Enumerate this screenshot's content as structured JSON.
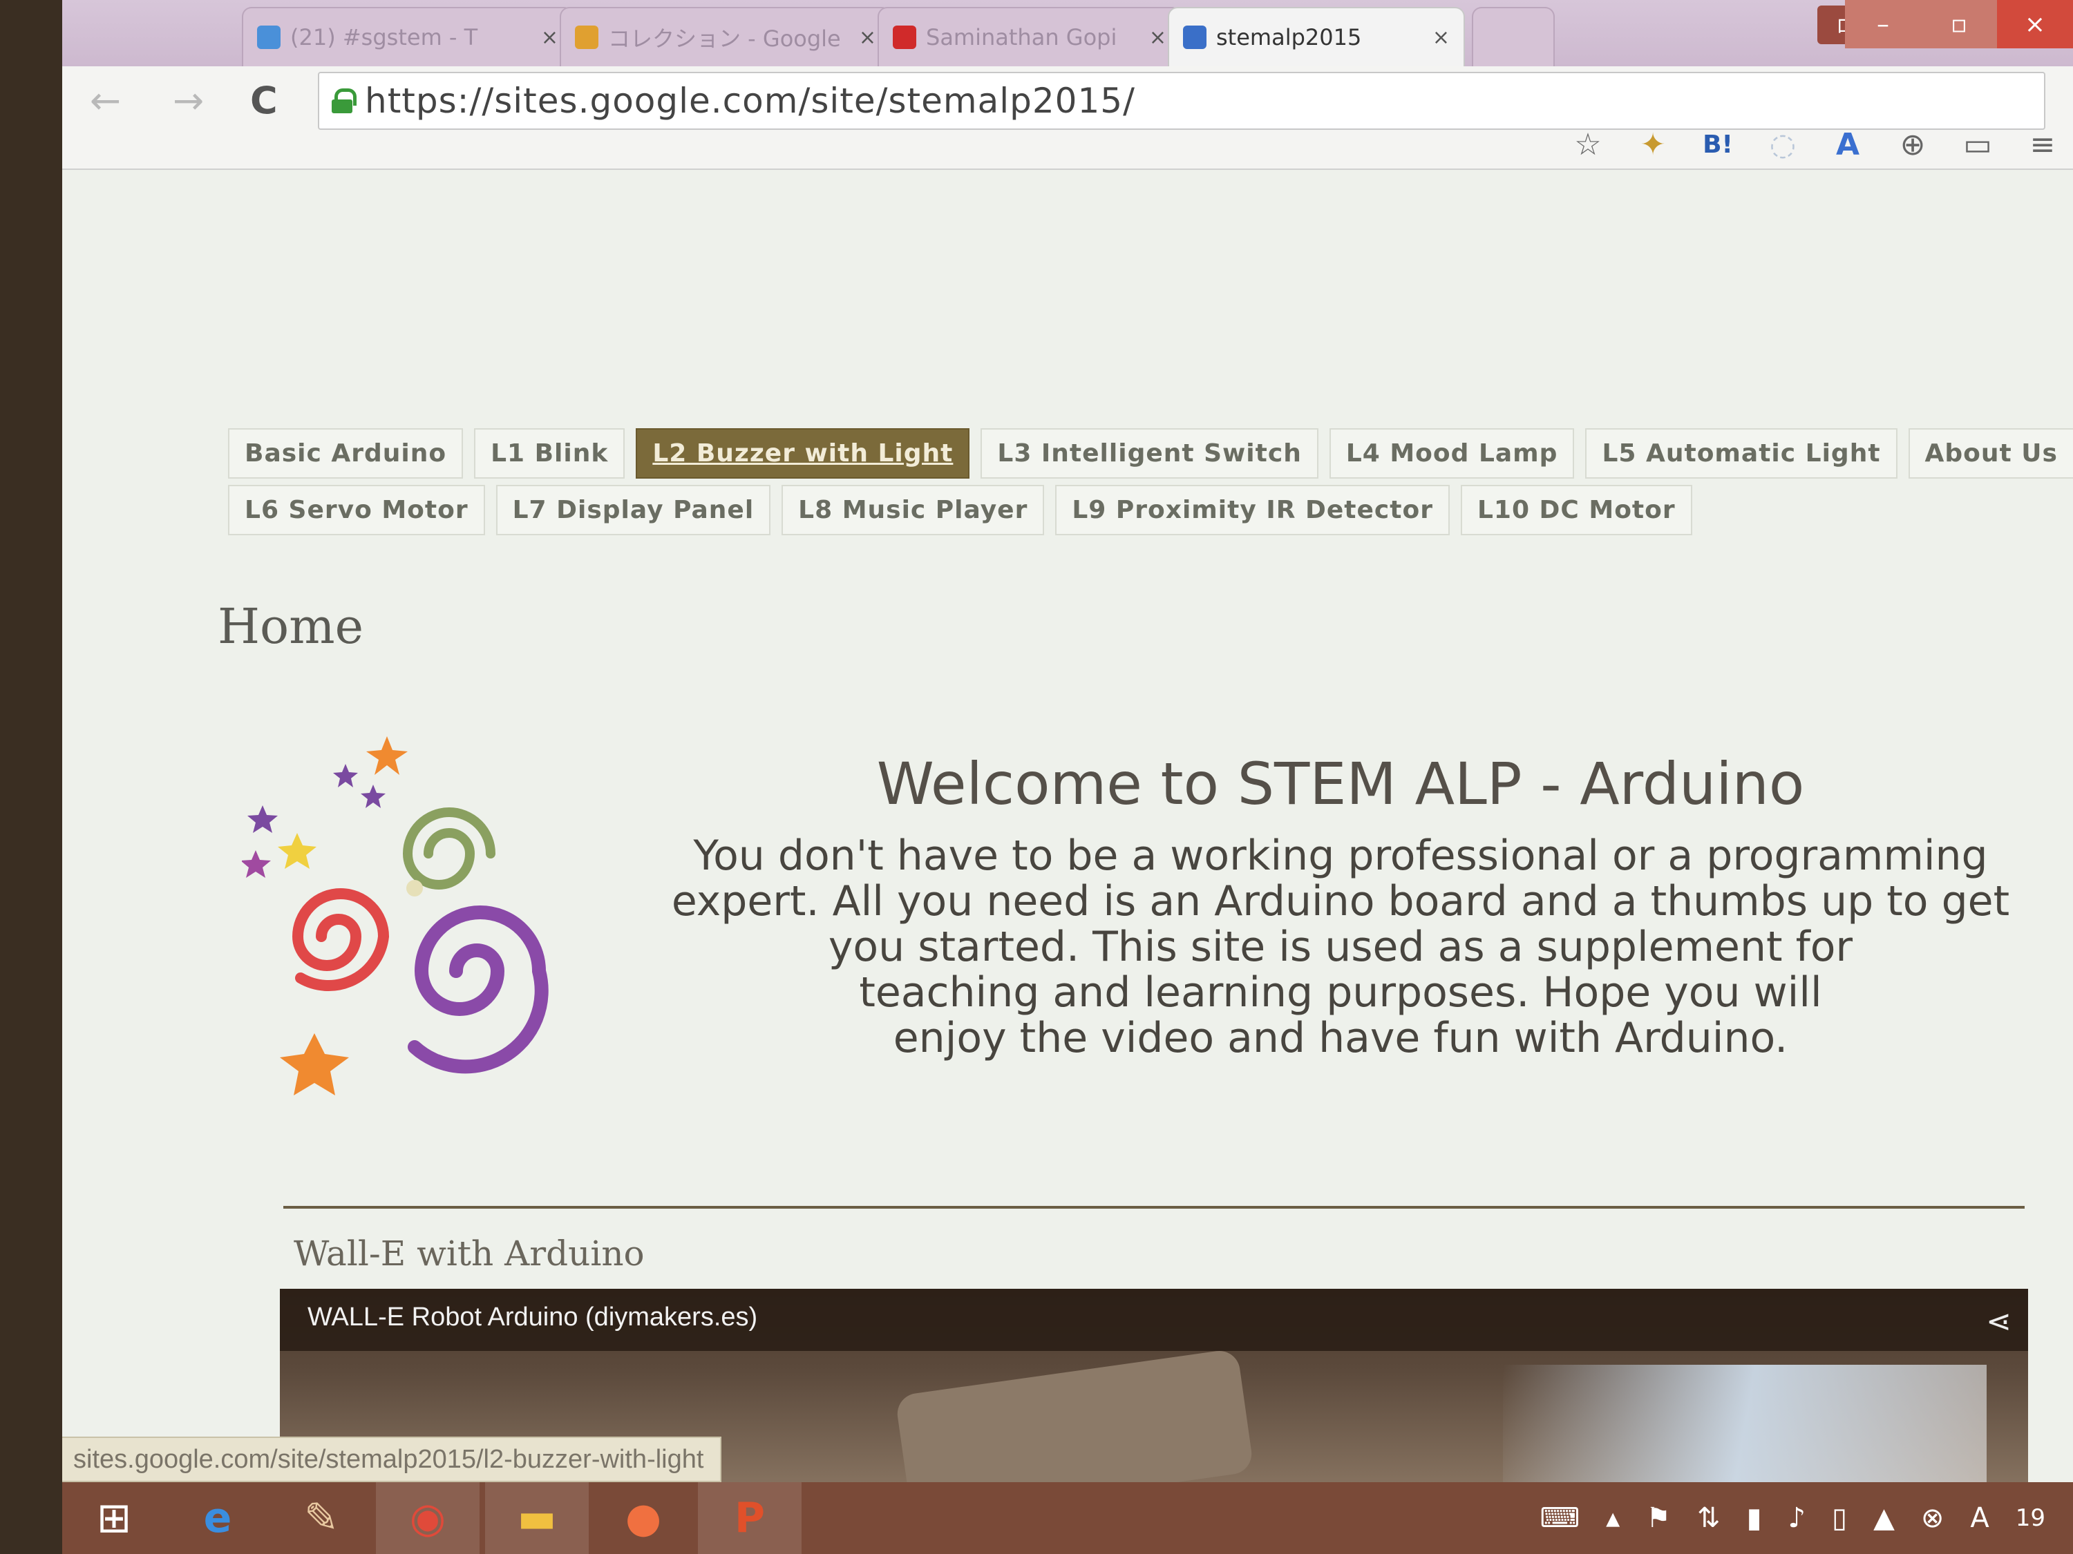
{
  "browser": {
    "tabs": [
      {
        "label": "(21) #sgstem - T",
        "icon": "twitter-icon",
        "icon_color": "#4a90d9"
      },
      {
        "label": "コレクション - Google",
        "icon": "google-icon",
        "icon_color": "#e0a030"
      },
      {
        "label": "Saminathan Gopi",
        "icon": "youtube-icon",
        "icon_color": "#d02a2a"
      },
      {
        "label": "stemalp2015",
        "icon": "sites-icon",
        "icon_color": "#3a6fc8",
        "active": true
      }
    ],
    "tab_close": "×",
    "new_tab": "",
    "profile_label": "ログ",
    "window_controls": {
      "minimize": "–",
      "restore": "▫",
      "close": "×"
    },
    "nav": {
      "back": "←",
      "forward": "→",
      "reload": "C"
    },
    "url": "https://sites.google.com/site/stemalp2015/",
    "extensions": [
      "star-icon",
      "puzzle-icon",
      "bookmark-icon",
      "ghost-icon",
      "translate-icon",
      "shield-icon",
      "cast-icon",
      "menu-icon"
    ],
    "extension_glyphs": [
      "☆",
      "✦",
      "B!",
      "◌",
      "A",
      "⊕",
      "▭",
      "≡"
    ]
  },
  "site": {
    "nav_row1": [
      "Basic Arduino",
      "L1 Blink",
      "L2 Buzzer with Light",
      "L3 Intelligent Switch",
      "L4 Mood Lamp",
      "L5 Automatic Light",
      "About Us"
    ],
    "nav_row2": [
      "L6 Servo Motor",
      "L7 Display Panel",
      "L8 Music Player",
      "L9 Proximity IR Detector",
      "L10 DC Motor"
    ],
    "selected_tab": "L2 Buzzer with Light",
    "page_title": "Home",
    "welcome_title": "Welcome to STEM ALP - Arduino",
    "welcome_lines": [
      "You don't have to be a working professional or a programming",
      "expert.  All you need is an Arduino board and a thumbs up to get",
      "you started. This site is used as a supplement for",
      "teaching and learning purposes. Hope you will",
      "enjoy the video and have fun with Arduino."
    ],
    "section_title": "Wall-E with Arduino",
    "video_title": "WALL-E Robot Arduino (diymakers.es)",
    "status_url": "sites.google.com/site/stemalp2015/l2-buzzer-with-light",
    "accent_color": "#7b6a3a"
  },
  "taskbar": {
    "apps": [
      "windows-start-icon",
      "internet-explorer-icon",
      "paint-icon",
      "chrome-icon",
      "file-explorer-icon",
      "app-orange-icon",
      "powerpoint-icon"
    ],
    "clock": "19"
  }
}
